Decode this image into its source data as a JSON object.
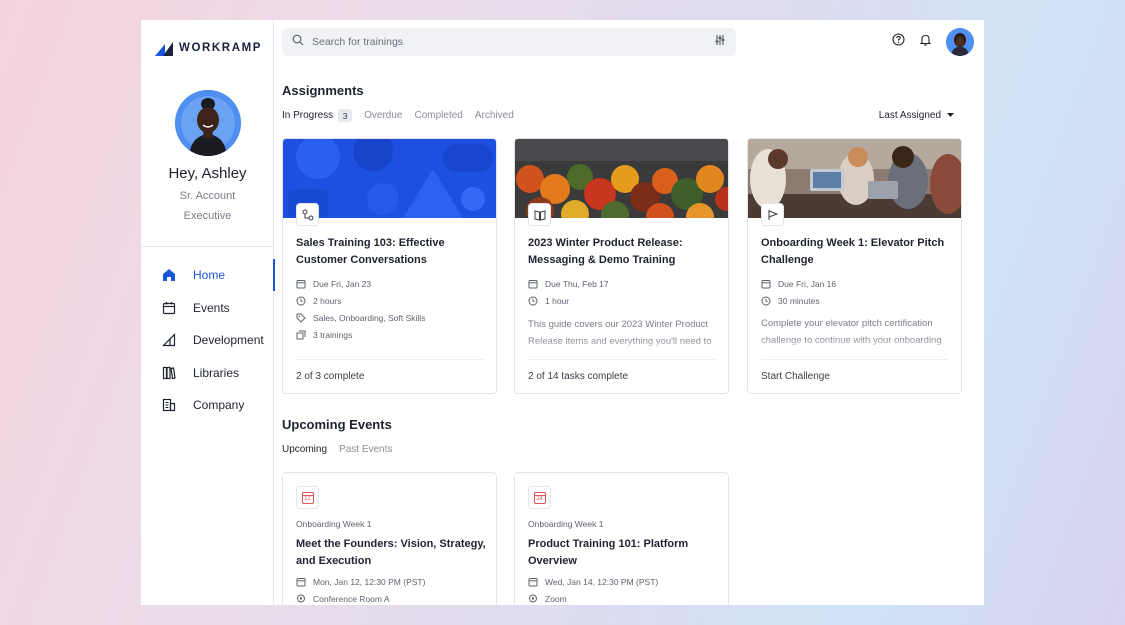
{
  "brand": {
    "name": "WORKRAMP",
    "color": "#1a56db"
  },
  "user": {
    "greeting": "Hey, Ashley",
    "role": "Sr. Account Executive"
  },
  "sidebar": {
    "items": [
      {
        "label": "Home",
        "icon": "home-icon",
        "active": true
      },
      {
        "label": "Events",
        "icon": "calendar-icon"
      },
      {
        "label": "Development",
        "icon": "ramp-icon"
      },
      {
        "label": "Libraries",
        "icon": "books-icon"
      },
      {
        "label": "Company",
        "icon": "building-icon"
      }
    ]
  },
  "header": {
    "search_placeholder": "Search for trainings",
    "icons": [
      "filter-icon",
      "help-icon",
      "bell-icon",
      "avatar"
    ]
  },
  "assignments": {
    "title": "Assignments",
    "tabs": [
      {
        "label": "In Progress",
        "count": "3",
        "active": true
      },
      {
        "label": "Overdue"
      },
      {
        "label": "Completed"
      },
      {
        "label": "Archived"
      }
    ],
    "sort_label": "Last Assigned",
    "cards": [
      {
        "type_icon": "path-icon",
        "title": "Sales Training 103: Effective Customer Conversations",
        "due": "Due Fri, Jan 23",
        "duration": "2 hours",
        "tags": "Sales, Onboarding, Soft Skills",
        "trainings": "3 trainings",
        "footer": "2 of 3 complete"
      },
      {
        "type_icon": "book-icon",
        "title": "2023 Winter Product Release: Messaging & Demo Training",
        "due": "Due Thu, Feb 17",
        "duration": "1 hour",
        "description": "This guide covers our 2023 Winter Product Release items and everything you'll need to effectively...",
        "footer": "2 of 14 tasks complete"
      },
      {
        "type_icon": "flag-icon",
        "title": "Onboarding Week 1: Elevator Pitch Challenge",
        "due": "Due Fri, Jan 16",
        "duration": "30 minutes",
        "description": "Complete your elevator pitch certification challenge to continue with your onboarding program.",
        "footer": "Start Challenge"
      }
    ]
  },
  "events": {
    "title": "Upcoming Events",
    "tabs": [
      {
        "label": "Upcoming",
        "active": true
      },
      {
        "label": "Past Events"
      }
    ],
    "cards": [
      {
        "day": "12",
        "series": "Onboarding Week 1",
        "title": "Meet the Founders: Vision, Strategy, and Execution",
        "when": "Mon, Jan 12, 12:30 PM (PST)",
        "where": "Conference Room A"
      },
      {
        "day": "24",
        "series": "Onboarding Week 1",
        "title": "Product Training 101: Platform Overview",
        "when": "Wed, Jan 14, 12:30 PM (PST)",
        "where": "Zoom"
      }
    ]
  }
}
